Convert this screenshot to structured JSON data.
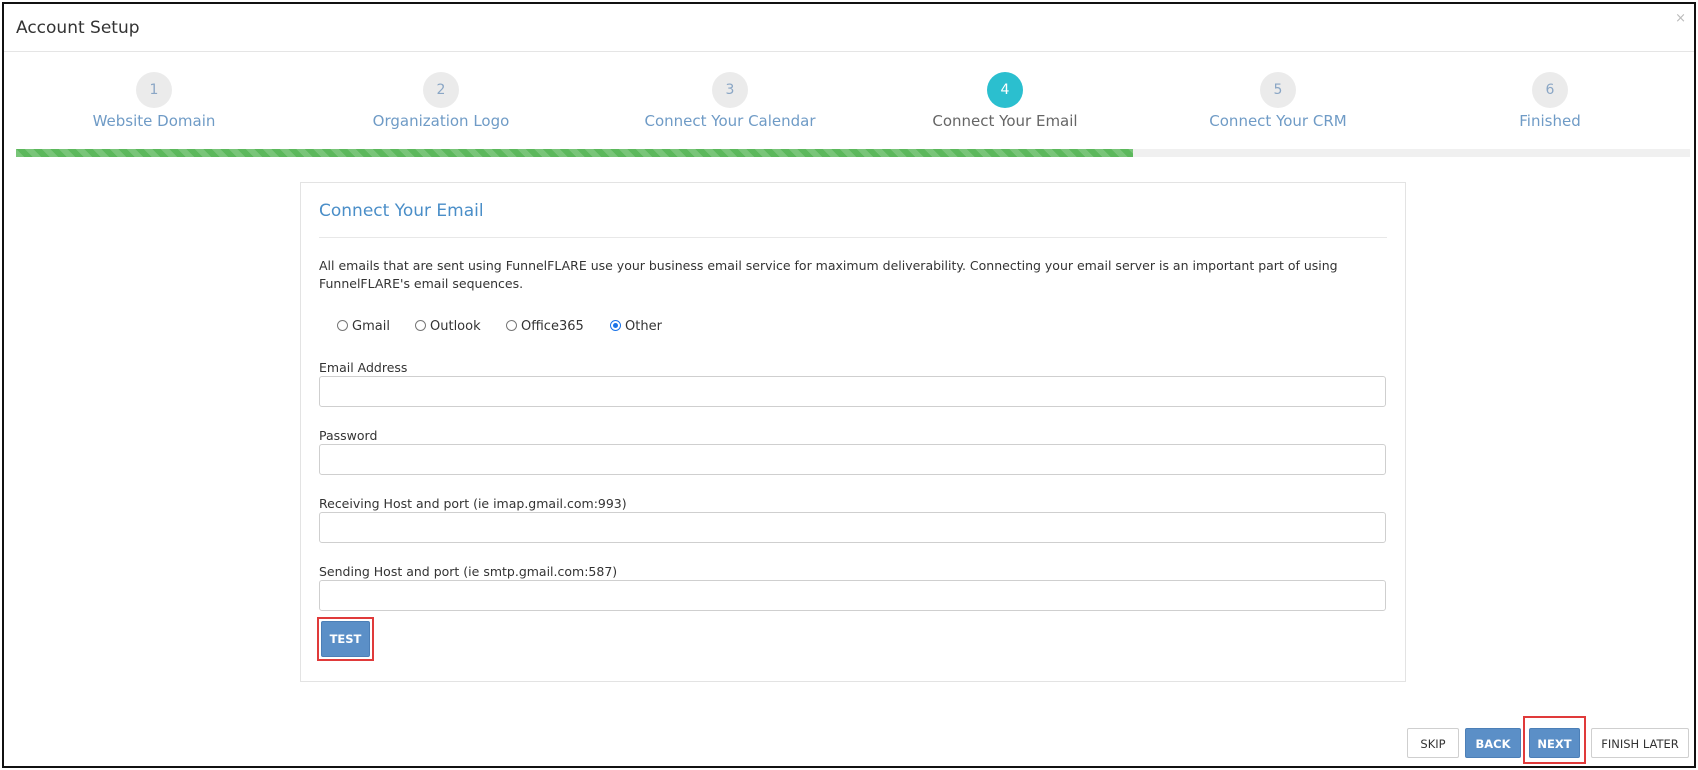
{
  "modal": {
    "title": "Account Setup",
    "close_icon": "×"
  },
  "steps": [
    {
      "number": "1",
      "label": "Website Domain",
      "active": false
    },
    {
      "number": "2",
      "label": "Organization Logo",
      "active": false
    },
    {
      "number": "3",
      "label": "Connect Your Calendar",
      "active": false
    },
    {
      "number": "4",
      "label": "Connect Your Email",
      "active": true
    },
    {
      "number": "5",
      "label": "Connect Your CRM",
      "active": false
    },
    {
      "number": "6",
      "label": "Finished",
      "active": false
    }
  ],
  "progress": {
    "percent": 66.7,
    "color": "#5cb85c"
  },
  "panel": {
    "title": "Connect Your Email",
    "description": "All emails that are sent using FunnelFLARE use your business email service for maximum deliverability. Connecting your email server is an important part of using FunnelFLARE's email sequences.",
    "providers": [
      {
        "label": "Gmail",
        "checked": false
      },
      {
        "label": "Outlook",
        "checked": false
      },
      {
        "label": "Office365",
        "checked": false
      },
      {
        "label": "Other",
        "checked": true
      }
    ],
    "fields": [
      {
        "label": "Email Address",
        "value": ""
      },
      {
        "label": "Password",
        "value": ""
      },
      {
        "label": "Receiving Host and port (ie imap.gmail.com:993)",
        "value": ""
      },
      {
        "label": "Sending Host and port (ie smtp.gmail.com:587)",
        "value": ""
      }
    ],
    "test_button": "TEST"
  },
  "footer": {
    "skip": "SKIP",
    "back": "BACK",
    "next": "NEXT",
    "finish_later": "FINISH LATER"
  },
  "colors": {
    "accent": "#5b8fc7",
    "active_step": "#2bbfcf",
    "highlight": "#e03a3a"
  }
}
